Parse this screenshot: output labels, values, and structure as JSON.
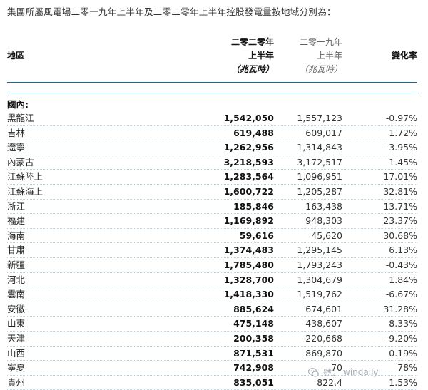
{
  "intro": "集團所屬風電場二零一九年上半年及二零二零年上半年控股發電量按地域分別為：",
  "headers": {
    "region": "地區",
    "col2020": [
      "二零二零年",
      "上半年",
      "（兆瓦時）"
    ],
    "col2019": [
      "二零一九年",
      "上半年",
      "（兆瓦時）"
    ],
    "change": "變化率"
  },
  "section": "國內:",
  "rows": [
    {
      "region": "黑龍江",
      "v2020": "1,542,050",
      "v2019": "1,557,123",
      "change": "-0.97%"
    },
    {
      "region": "吉林",
      "v2020": "619,488",
      "v2019": "609,017",
      "change": "1.72%"
    },
    {
      "region": "遼寧",
      "v2020": "1,262,956",
      "v2019": "1,314,843",
      "change": "-3.95%"
    },
    {
      "region": "內蒙古",
      "v2020": "3,218,593",
      "v2019": "3,172,517",
      "change": "1.45%"
    },
    {
      "region": "江蘇陸上",
      "v2020": "1,283,564",
      "v2019": "1,096,951",
      "change": "17.01%"
    },
    {
      "region": "江蘇海上",
      "v2020": "1,600,722",
      "v2019": "1,205,287",
      "change": "32.81%"
    },
    {
      "region": "浙江",
      "v2020": "185,846",
      "v2019": "163,438",
      "change": "13.71%"
    },
    {
      "region": "福建",
      "v2020": "1,169,892",
      "v2019": "948,303",
      "change": "23.37%"
    },
    {
      "region": "海南",
      "v2020": "59,616",
      "v2019": "45,620",
      "change": "30.68%"
    },
    {
      "region": "甘肅",
      "v2020": "1,374,483",
      "v2019": "1,295,145",
      "change": "6.13%"
    },
    {
      "region": "新疆",
      "v2020": "1,785,480",
      "v2019": "1,793,243",
      "change": "-0.43%"
    },
    {
      "region": "河北",
      "v2020": "1,328,700",
      "v2019": "1,304,679",
      "change": "1.84%"
    },
    {
      "region": "雲南",
      "v2020": "1,418,330",
      "v2019": "1,519,762",
      "change": "-6.67%"
    },
    {
      "region": "安徽",
      "v2020": "885,624",
      "v2019": "674,601",
      "change": "31.28%"
    },
    {
      "region": "山東",
      "v2020": "475,148",
      "v2019": "438,607",
      "change": "8.33%"
    },
    {
      "region": "天津",
      "v2020": "200,358",
      "v2019": "220,668",
      "change": "-9.20%"
    },
    {
      "region": "山西",
      "v2020": "871,531",
      "v2019": "869,870",
      "change": "0.19%"
    },
    {
      "region": "寧夏",
      "v2020": "742,908",
      "v2019": "70",
      "change": "78%"
    },
    {
      "region": "貴州",
      "v2020": "835,051",
      "v2019": "822,4",
      "change": "1.53%"
    }
  ],
  "watermark": {
    "icon": "wechat-logo-icon",
    "label": "號：",
    "handle": "windaily"
  },
  "colors": {
    "rule": "#0d6f98",
    "row_divider": "#b9d3e2"
  }
}
